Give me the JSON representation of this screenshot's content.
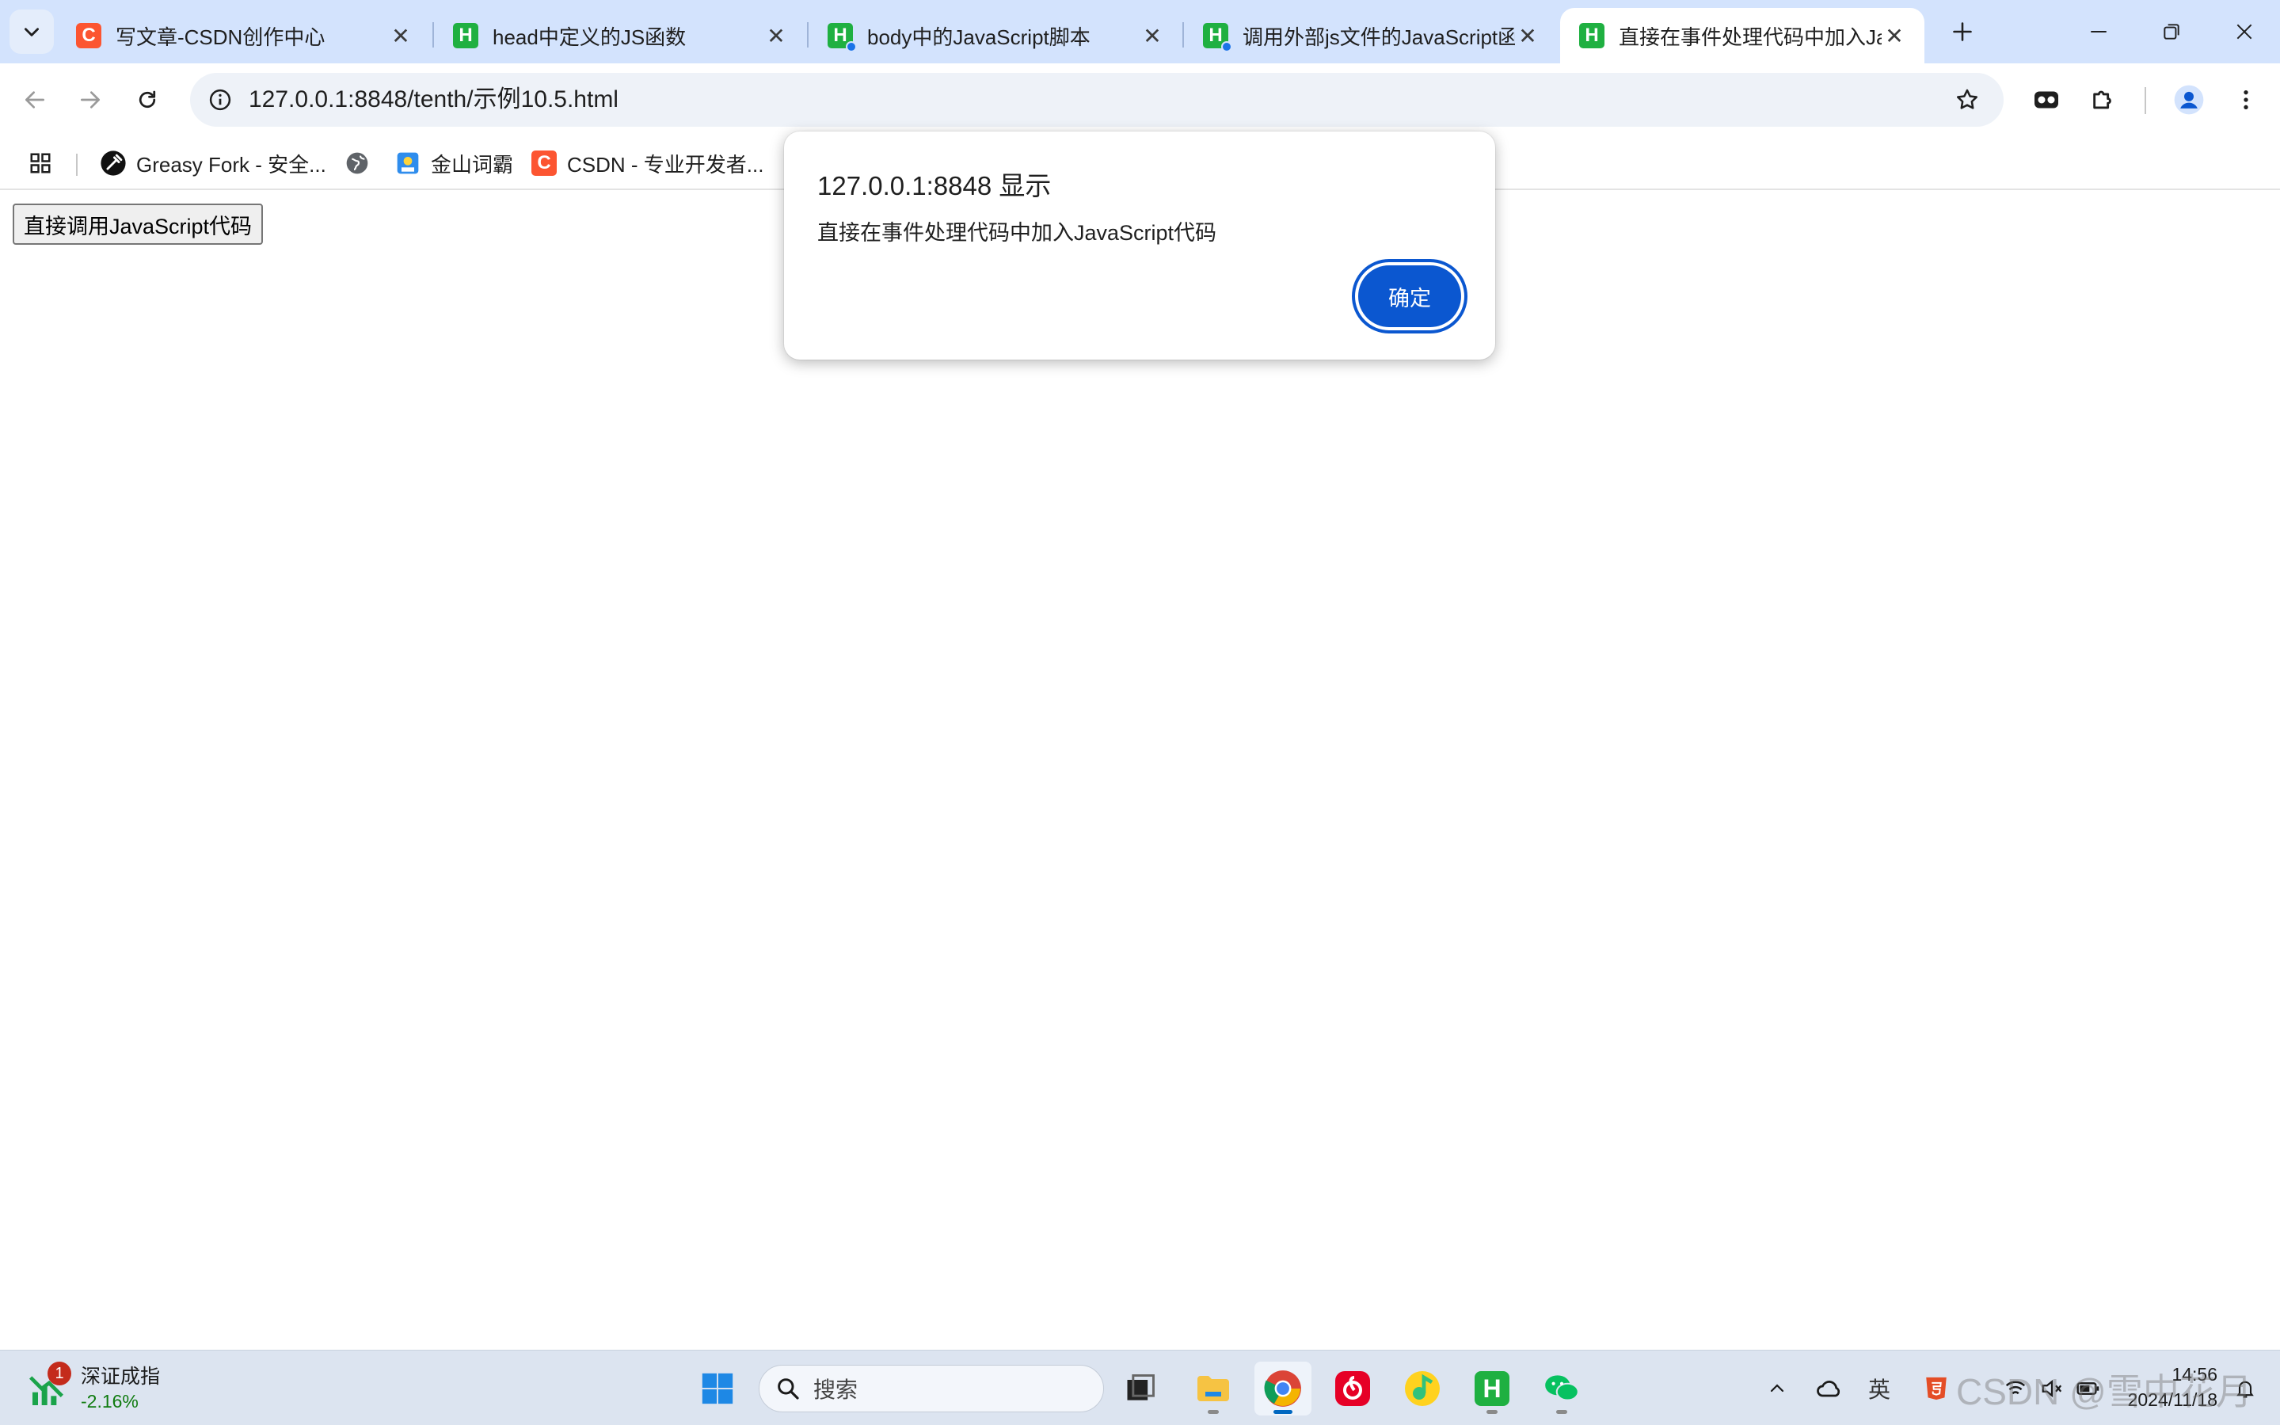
{
  "tabs": [
    {
      "title": "写文章-CSDN创作中心",
      "icon": "csdn-icon",
      "active": false
    },
    {
      "title": "head中定义的JS函数",
      "icon": "hbuilder-icon",
      "active": false
    },
    {
      "title": "body中的JavaScript脚本",
      "icon": "hbuilder-icon",
      "active": false
    },
    {
      "title": "调用外部js文件的JavaScript函",
      "icon": "hbuilder-icon",
      "active": false
    },
    {
      "title": "直接在事件处理代码中加入Java",
      "icon": "hbuilder-icon",
      "active": true
    }
  ],
  "address_bar": {
    "url": "127.0.0.1:8848/tenth/示例10.5.html"
  },
  "bookmarks": [
    {
      "label": "Greasy Fork - 安全...",
      "icon": "greasyfork-icon"
    },
    {
      "label": "",
      "icon": "globe-icon"
    },
    {
      "label": "金山词霸",
      "icon": "iciba-icon"
    },
    {
      "label": "CSDN - 专业开发者...",
      "icon": "csdn-icon"
    }
  ],
  "page": {
    "button_label": "直接调用JavaScript代码"
  },
  "dialog": {
    "title": "127.0.0.1:8848 显示",
    "message": "直接在事件处理代码中加入JavaScript代码",
    "ok_label": "确定"
  },
  "taskbar": {
    "widget": {
      "name": "深证成指",
      "value": "-2.16%",
      "badge": "1"
    },
    "search_placeholder": "搜索",
    "apps": [
      "task-view",
      "file-explorer",
      "chrome",
      "netease-music",
      "qq-music",
      "hbuilder",
      "wechat"
    ],
    "active_app": "chrome",
    "tray_ime": "英",
    "time": "14:56",
    "date": "2024/11/18",
    "watermark": "CSDN @雪中花月"
  },
  "colors": {
    "tab_strip": "#d3e3fd",
    "accent": "#0b57d0",
    "csdn": "#fc5531",
    "hbuilder": "#1fb041"
  }
}
